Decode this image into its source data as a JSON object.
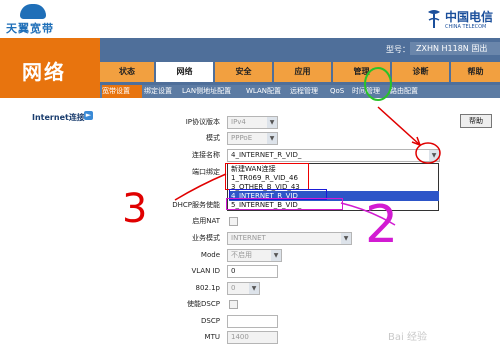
{
  "brand": {
    "left_logo": "天翼宽带",
    "right_logo_zh": "中国电信",
    "right_logo_en": "CHINA TELECOM"
  },
  "header": {
    "section_title": "网络",
    "device_label": "型号：",
    "device_value": "ZXHN H118N 固出"
  },
  "menu": {
    "tabs": [
      "状态",
      "网络",
      "安全",
      "应用",
      "管理",
      "诊断",
      "帮助"
    ],
    "active": "网络"
  },
  "submenu": {
    "items": [
      "宽带设置",
      "绑定设置",
      "LAN侧地址配置",
      "WLAN配置",
      "远程管理",
      "QoS",
      "时间管理",
      "路由配置"
    ],
    "active": "宽带设置"
  },
  "sidebar": {
    "item": "Internet连接"
  },
  "help": {
    "label": "帮助"
  },
  "form": {
    "ip_version": {
      "label": "IP协议版本",
      "value": "IPv4"
    },
    "mode": {
      "label": "模式",
      "value": "PPPoE"
    },
    "connection_name": {
      "label": "连接名称",
      "value": "4_INTERNET_R_VID_"
    },
    "port_binding": {
      "label": "端口绑定"
    },
    "dhcp_enable": {
      "label": "DHCP服务使能"
    },
    "enable_nat": {
      "label": "启用NAT"
    },
    "service_mode": {
      "label": "业务模式",
      "value": "INTERNET"
    },
    "vlan_mode": {
      "label": "Mode",
      "value": "不启用"
    },
    "vlan_id": {
      "label": "VLAN ID",
      "value": "0"
    },
    "dot1p": {
      "label": "802.1p",
      "value": "0"
    },
    "enable_dscp": {
      "label": "使能DSCP"
    },
    "dscp": {
      "label": "DSCP",
      "value": ""
    },
    "mtu": {
      "label": "MTU",
      "value": "1400"
    }
  },
  "dropdown": {
    "options": [
      "新建WAN连接",
      "1_TR069_R_VID_46",
      "3_OTHER_B_VID_43",
      "4_INTERNET_R_VID_",
      "5_INTERNET_B_VID_"
    ],
    "selected": "4_INTERNET_R_VID_"
  },
  "annotations": {
    "number_2": "2",
    "number_3": "3"
  },
  "watermark": {
    "text": "Bai 经验"
  },
  "colors": {
    "orange": "#e8740e",
    "header_blue": "#4f6f9a",
    "selected_blue": "#2d55c8",
    "annotation_red": "#e00000",
    "annotation_magenta": "#d21bd2",
    "annotation_green": "#29c229"
  }
}
